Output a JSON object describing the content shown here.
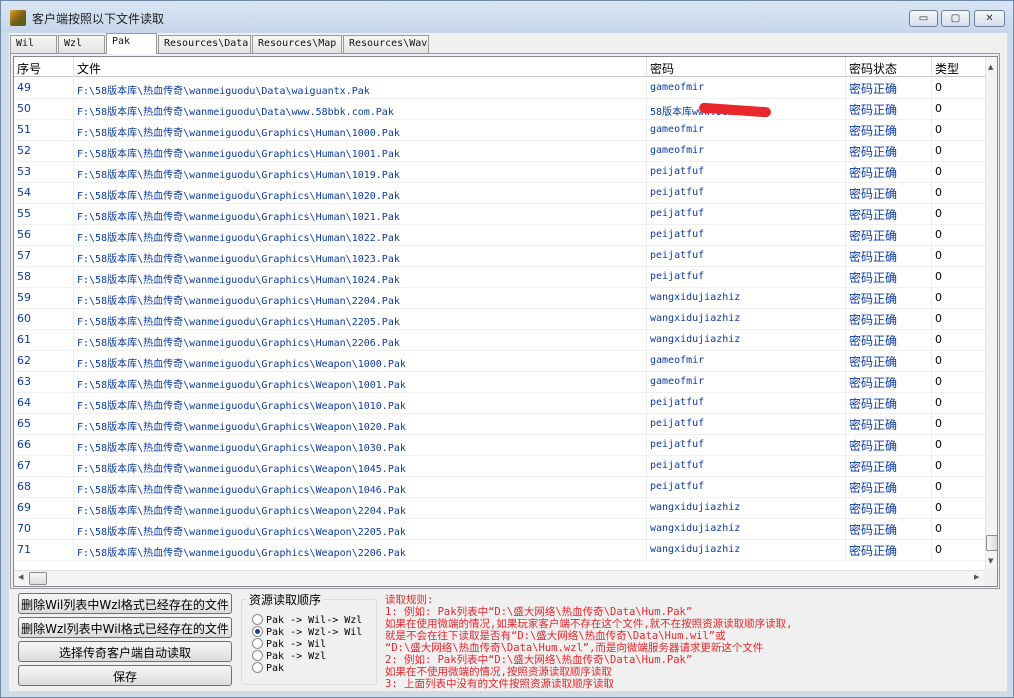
{
  "window": {
    "title": "客户端按照以下文件读取",
    "min_label": "▭",
    "max_label": "▢",
    "close_label": "✕"
  },
  "tabs": [
    "Wil",
    "Wzl",
    "Pak",
    "Resources\\Data",
    "Resources\\Map",
    "Resources\\Wav"
  ],
  "active_tab": "Pak",
  "table": {
    "headers": [
      "序号",
      "文件",
      "密码",
      "密码状态",
      "类型"
    ],
    "rows": [
      [
        "49",
        "F:\\58版本库\\热血传奇\\wanmeiguodu\\Data\\waiguantx.Pak",
        "gameofmir",
        "密码正确",
        "0"
      ],
      [
        "50",
        "F:\\58版本库\\热血传奇\\wanmeiguodu\\Data\\www.58bbk.com.Pak",
        "58版本库www.58bbk.com",
        "密码正确",
        "0"
      ],
      [
        "51",
        "F:\\58版本库\\热血传奇\\wanmeiguodu\\Graphics\\Human\\1000.Pak",
        "gameofmir",
        "密码正确",
        "0"
      ],
      [
        "52",
        "F:\\58版本库\\热血传奇\\wanmeiguodu\\Graphics\\Human\\1001.Pak",
        "gameofmir",
        "密码正确",
        "0"
      ],
      [
        "53",
        "F:\\58版本库\\热血传奇\\wanmeiguodu\\Graphics\\Human\\1019.Pak",
        "peijatfuf",
        "密码正确",
        "0"
      ],
      [
        "54",
        "F:\\58版本库\\热血传奇\\wanmeiguodu\\Graphics\\Human\\1020.Pak",
        "peijatfuf",
        "密码正确",
        "0"
      ],
      [
        "55",
        "F:\\58版本库\\热血传奇\\wanmeiguodu\\Graphics\\Human\\1021.Pak",
        "peijatfuf",
        "密码正确",
        "0"
      ],
      [
        "56",
        "F:\\58版本库\\热血传奇\\wanmeiguodu\\Graphics\\Human\\1022.Pak",
        "peijatfuf",
        "密码正确",
        "0"
      ],
      [
        "57",
        "F:\\58版本库\\热血传奇\\wanmeiguodu\\Graphics\\Human\\1023.Pak",
        "peijatfuf",
        "密码正确",
        "0"
      ],
      [
        "58",
        "F:\\58版本库\\热血传奇\\wanmeiguodu\\Graphics\\Human\\1024.Pak",
        "peijatfuf",
        "密码正确",
        "0"
      ],
      [
        "59",
        "F:\\58版本库\\热血传奇\\wanmeiguodu\\Graphics\\Human\\2204.Pak",
        "wangxidujiazhiz",
        "密码正确",
        "0"
      ],
      [
        "60",
        "F:\\58版本库\\热血传奇\\wanmeiguodu\\Graphics\\Human\\2205.Pak",
        "wangxidujiazhiz",
        "密码正确",
        "0"
      ],
      [
        "61",
        "F:\\58版本库\\热血传奇\\wanmeiguodu\\Graphics\\Human\\2206.Pak",
        "wangxidujiazhiz",
        "密码正确",
        "0"
      ],
      [
        "62",
        "F:\\58版本库\\热血传奇\\wanmeiguodu\\Graphics\\Weapon\\1000.Pak",
        "gameofmir",
        "密码正确",
        "0"
      ],
      [
        "63",
        "F:\\58版本库\\热血传奇\\wanmeiguodu\\Graphics\\Weapon\\1001.Pak",
        "gameofmir",
        "密码正确",
        "0"
      ],
      [
        "64",
        "F:\\58版本库\\热血传奇\\wanmeiguodu\\Graphics\\Weapon\\1010.Pak",
        "peijatfuf",
        "密码正确",
        "0"
      ],
      [
        "65",
        "F:\\58版本库\\热血传奇\\wanmeiguodu\\Graphics\\Weapon\\1020.Pak",
        "peijatfuf",
        "密码正确",
        "0"
      ],
      [
        "66",
        "F:\\58版本库\\热血传奇\\wanmeiguodu\\Graphics\\Weapon\\1030.Pak",
        "peijatfuf",
        "密码正确",
        "0"
      ],
      [
        "67",
        "F:\\58版本库\\热血传奇\\wanmeiguodu\\Graphics\\Weapon\\1045.Pak",
        "peijatfuf",
        "密码正确",
        "0"
      ],
      [
        "68",
        "F:\\58版本库\\热血传奇\\wanmeiguodu\\Graphics\\Weapon\\1046.Pak",
        "peijatfuf",
        "密码正确",
        "0"
      ],
      [
        "69",
        "F:\\58版本库\\热血传奇\\wanmeiguodu\\Graphics\\Weapon\\2204.Pak",
        "wangxidujiazhiz",
        "密码正确",
        "0"
      ],
      [
        "70",
        "F:\\58版本库\\热血传奇\\wanmeiguodu\\Graphics\\Weapon\\2205.Pak",
        "wangxidujiazhiz",
        "密码正确",
        "0"
      ],
      [
        "71",
        "F:\\58版本库\\热血传奇\\wanmeiguodu\\Graphics\\Weapon\\2206.Pak",
        "wangxidujiazhiz",
        "密码正确",
        "0"
      ]
    ]
  },
  "buttons": {
    "delete_wzl_in_wil": "删除Wil列表中Wzl格式已经存在的文件",
    "delete_wil_in_wzl": "删除Wzl列表中Wil格式已经存在的文件",
    "select_client": "选择传奇客户端自动读取",
    "save": "保存"
  },
  "resource_order": {
    "title": "资源读取顺序",
    "options": [
      "Pak -> Wil-> Wzl",
      "Pak -> Wzl-> Wil",
      "Pak -> Wil",
      "Pak -> Wzl",
      "Pak"
    ],
    "selected": "Pak -> Wzl-> Wil"
  },
  "rules": [
    "读取规则:",
    "1: 例如: Pak列表中“D:\\盛大网络\\热血传奇\\Data\\Hum.Pak”",
    "    如果在使用微端的情况,如果玩家客户端不存在这个文件,就不在按照资源读取顺序读取,",
    "    就是不会在往下读取是否有“D:\\盛大网络\\热血传奇\\Data\\Hum.wil”或",
    "    “D:\\盛大网络\\热血传奇\\Data\\Hum.wzl”,而是向微端服务器请求更新这个文件",
    "2: 例如: Pak列表中“D:\\盛大网络\\热血传奇\\Data\\Hum.Pak”",
    "    如果在不使用微端的情况,按照资源读取顺序读取",
    "3: 上面列表中没有的文件按照资源读取顺序读取"
  ],
  "colors": {
    "link_blue": "#0b3a9e",
    "rule_red": "#e8262b"
  }
}
